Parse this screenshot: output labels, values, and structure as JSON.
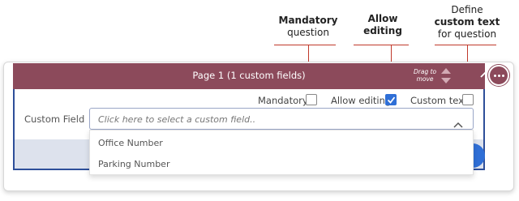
{
  "callouts": {
    "mandatory": {
      "line1": "Mandatory",
      "line2": "question"
    },
    "allow_editing": {
      "line1": "Allow",
      "line2": "editing"
    },
    "custom_text": {
      "line1": "Define",
      "line2": "custom text",
      "line3": "for question"
    }
  },
  "header": {
    "title": "Page 1 (1 custom fields)",
    "drag_hint_line1": "Drag to",
    "drag_hint_line2": "move",
    "more_icon": "more-horizontal-icon",
    "collapse_icon": "chevron-up-icon"
  },
  "options": {
    "mandatory_label": "Mandatory",
    "mandatory_checked": false,
    "allow_editing_label": "Allow editing",
    "allow_editing_checked": true,
    "custom_text_label": "Custom text",
    "custom_text_checked": false
  },
  "field": {
    "label": "Custom Field",
    "placeholder": "Click here to select a custom field..",
    "options": [
      "Office Number",
      "Parking Number"
    ]
  },
  "colors": {
    "header_bg": "#8c4a5b",
    "panel_border": "#2e4f9a",
    "checkbox_checked": "#2f6fd6",
    "callout_line": "#c0392b"
  }
}
